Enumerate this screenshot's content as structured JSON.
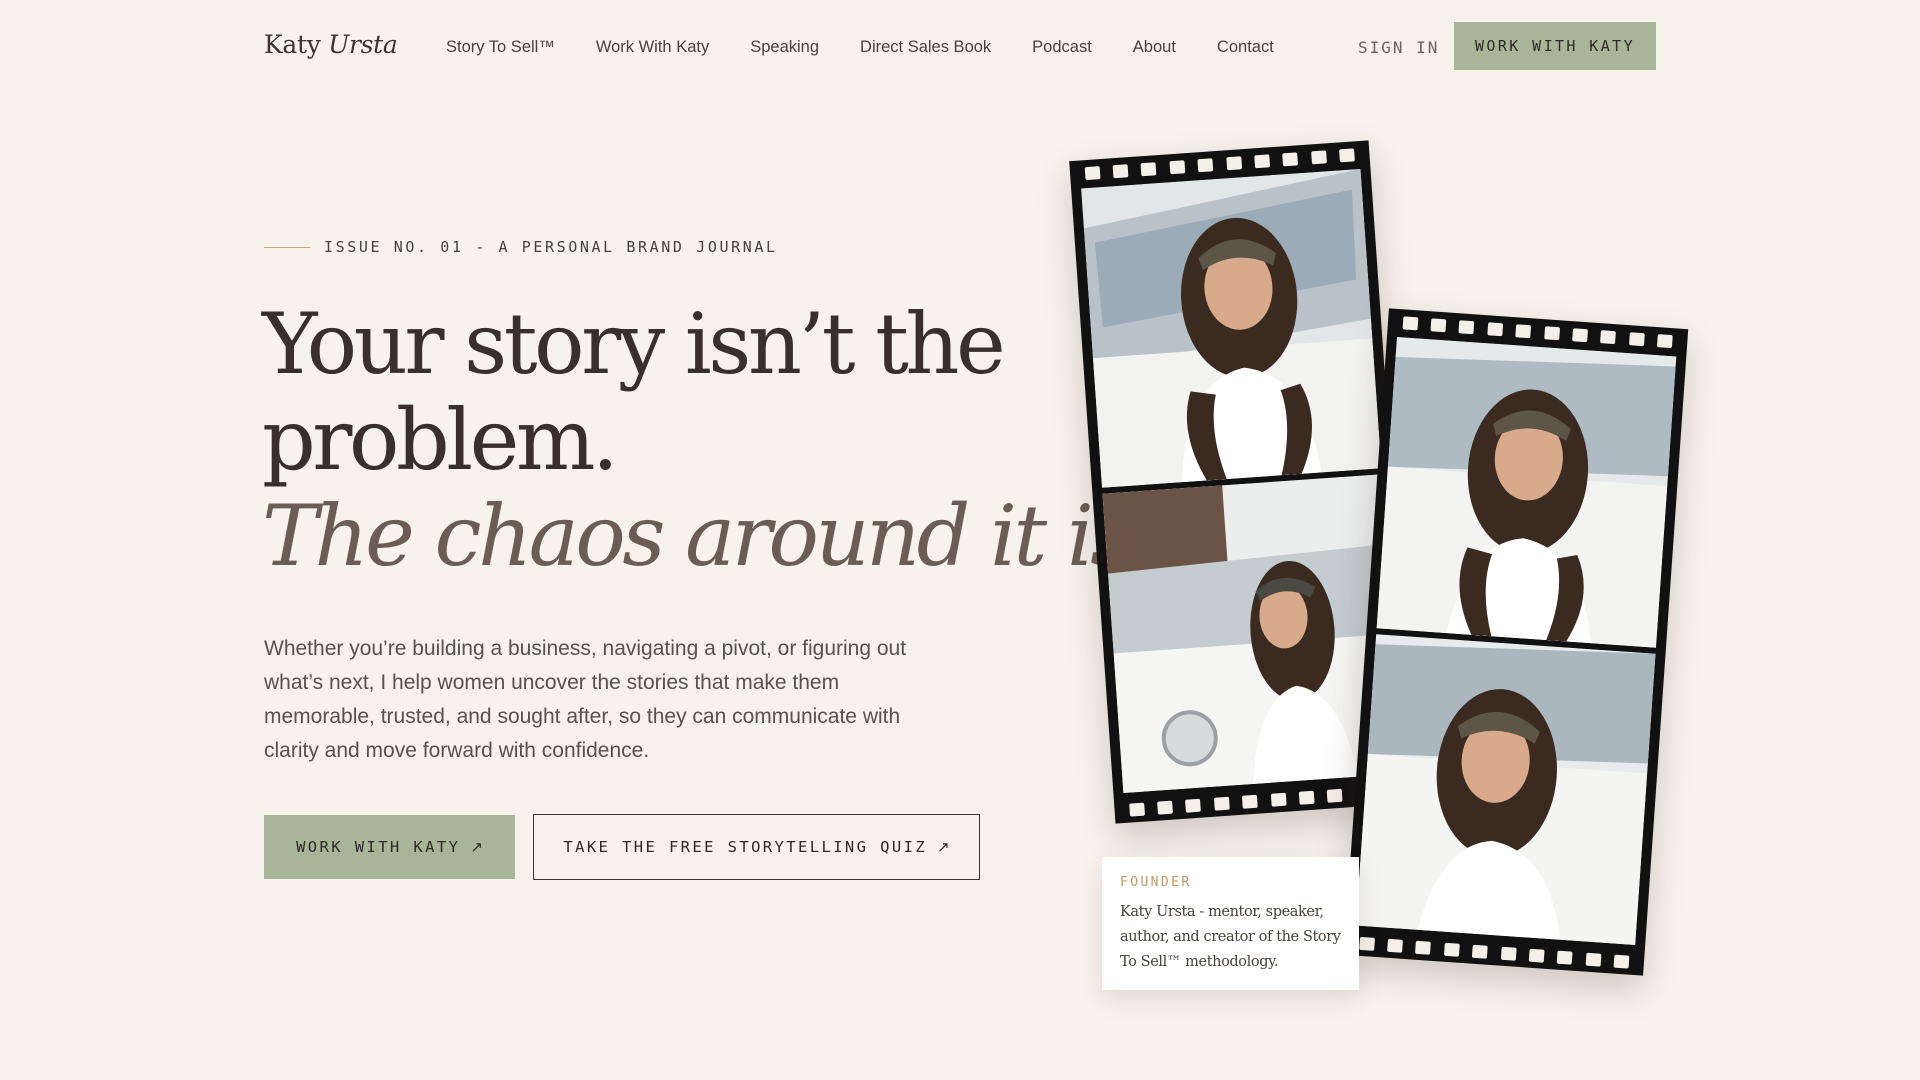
{
  "brand": {
    "first": "Katy",
    "last": "Ursta"
  },
  "nav": {
    "items": [
      "Story To Sell™",
      "Work With Katy",
      "Speaking",
      "Direct Sales Book",
      "Podcast",
      "About",
      "Contact"
    ],
    "signin": "SIGN IN",
    "cta": "WORK WITH KATY"
  },
  "hero": {
    "eyebrow": "ISSUE NO. 01 - A PERSONAL BRAND JOURNAL",
    "headline_1": "Your story isn’t the",
    "headline_2": "problem.",
    "headline_3": "The chaos around it is.",
    "body": "Whether you’re building a business, navigating a pivot, or figuring out what’s next, I help women uncover the stories that make them memorable, trusted, and sought after, so they can communicate with clarity and move forward with confidence.",
    "primary_cta": "WORK WITH KATY",
    "secondary_cta": "TAKE THE FREE STORYTELLING QUIZ",
    "arrow": "↗"
  },
  "founder_card": {
    "label": "FOUNDER",
    "text": "Katy Ursta - mentor, speaker, author, and creator of the Story To Sell™ methodology."
  },
  "colors": {
    "background": "#f8f2ec",
    "sage": "#a8b598",
    "text": "#3c3330",
    "accent_gold": "#c49a5e"
  }
}
